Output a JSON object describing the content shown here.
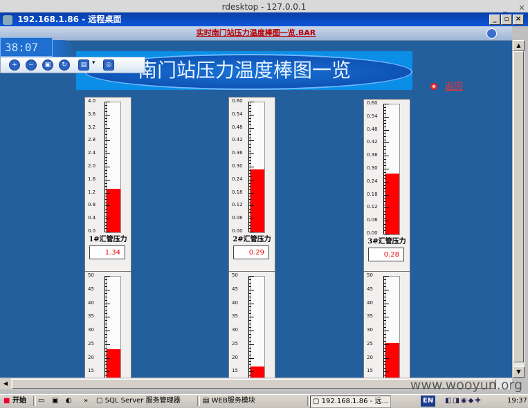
{
  "host": {
    "window_title": "rdesktop - 127.0.0.1",
    "session_title": "192.168.1.86 - 远程桌面",
    "window_controls": [
      "_",
      "×"
    ]
  },
  "app": {
    "doc_title": "实时南门站压力温度棒图一览.BAR",
    "clock": "38:07",
    "banner": "南门站压力温度棒图一览",
    "return_label": "返回",
    "toolbar": [
      "zoom-in",
      "zoom-out",
      "fit",
      "refresh",
      "chart-mode",
      "dropdown",
      "settings"
    ]
  },
  "gauges": [
    {
      "label": "1#汇管压力",
      "value": "1.34",
      "ticks": [
        "4.0",
        "3.6",
        "3.2",
        "2.8",
        "2.4",
        "2.0",
        "1.6",
        "1.2",
        "0.8",
        "0.4",
        "0.0"
      ],
      "max": 4.0,
      "level": 1.34
    },
    {
      "label": "2#汇管压力",
      "value": "0.29",
      "ticks": [
        "0.60",
        "0.54",
        "0.48",
        "0.42",
        "0.36",
        "0.30",
        "0.24",
        "0.18",
        "0.12",
        "0.06",
        "0.00"
      ],
      "max": 0.6,
      "level": 0.29
    },
    {
      "label": "3#汇管压力",
      "value": "0.28",
      "ticks": [
        "0.60",
        "0.54",
        "0.48",
        "0.42",
        "0.36",
        "0.30",
        "0.24",
        "0.18",
        "0.12",
        "0.06",
        "0.00"
      ],
      "max": 0.6,
      "level": 0.28
    },
    {
      "label": "",
      "value": "",
      "ticks": [
        "50",
        "45",
        "40",
        "35",
        "30",
        "25",
        "20",
        "15",
        "10"
      ],
      "max": 50,
      "level": 23.3
    },
    {
      "label": "",
      "value": "",
      "ticks": [
        "50",
        "45",
        "40",
        "35",
        "30",
        "25",
        "20",
        "15",
        "10"
      ],
      "max": 50,
      "level": 17.1
    },
    {
      "label": "",
      "value": "",
      "ticks": [
        "50",
        "45",
        "40",
        "35",
        "30",
        "25",
        "20",
        "15",
        "10"
      ],
      "max": 50,
      "level": 25.8
    }
  ],
  "taskbar": {
    "start": "开始",
    "items": [
      "SQL Server 服务管理器",
      "WEB服务模块",
      "192.168.1.86 - 远..."
    ],
    "lang": "EN",
    "time": "19:37"
  },
  "watermark": "www.wooyun.org"
}
